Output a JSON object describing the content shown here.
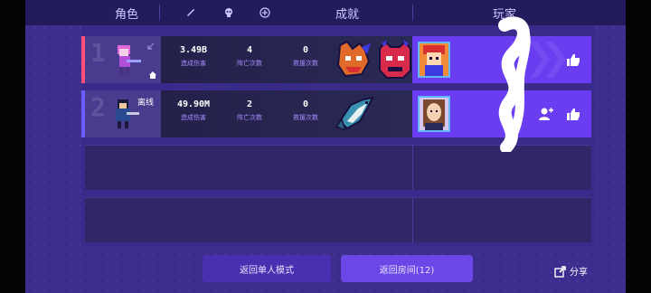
{
  "header": {
    "character_label": "角色",
    "achievement_label": "成就",
    "player_label": "玩家"
  },
  "rows": [
    {
      "rank": "1",
      "damage": "3.49B",
      "damage_label": "造成伤害",
      "deaths": "4",
      "deaths_label": "阵亡次数",
      "rescues": "0",
      "rescues_label": "救援次数",
      "status_text": "",
      "accent": "#ff4f7a"
    },
    {
      "rank": "2",
      "damage": "49.90M",
      "damage_label": "造成伤害",
      "deaths": "2",
      "deaths_label": "阵亡次数",
      "rescues": "0",
      "rescues_label": "救援次数",
      "status_text": "离线",
      "accent": "#6a5cff"
    }
  ],
  "buttons": {
    "return_single": "返回单人模式",
    "return_room": "返回房间(12)",
    "share": "分享"
  },
  "colors": {
    "background": "#3c2d8e",
    "header": "#221b5c",
    "player_cell": "#6a3df0",
    "return_room_button": "#6b47e8",
    "return_single_button": "#4a2fb0"
  }
}
